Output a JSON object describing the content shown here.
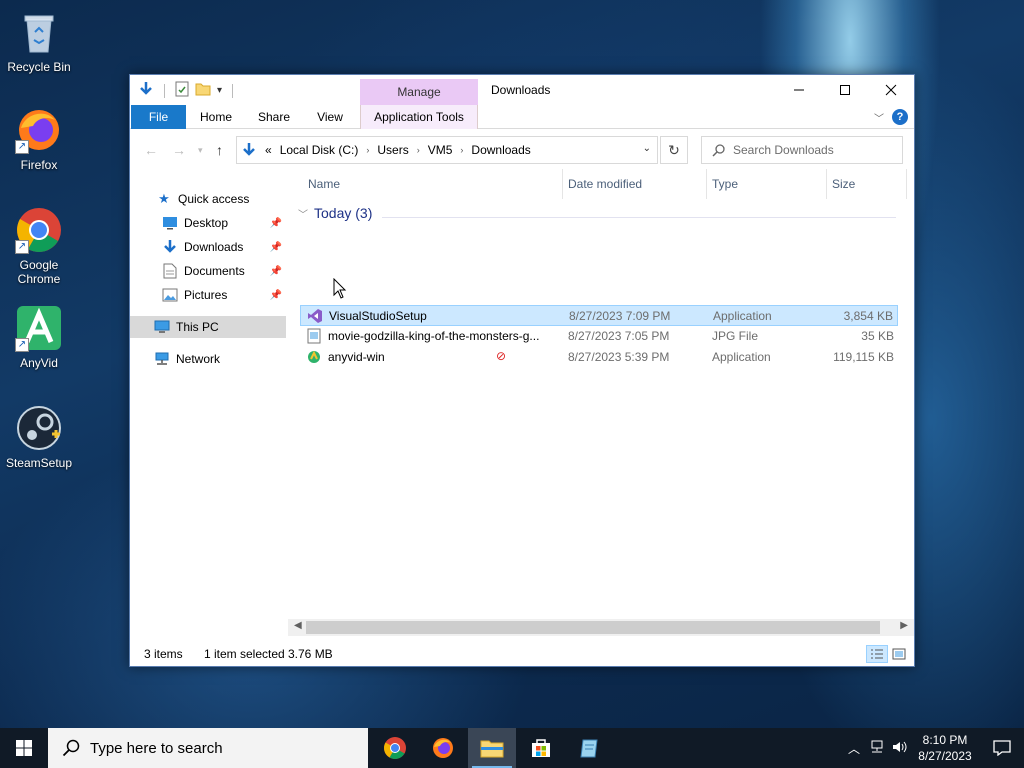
{
  "desktop": {
    "icons": [
      {
        "label": "Recycle Bin"
      },
      {
        "label": "Firefox"
      },
      {
        "label": "Google Chrome"
      },
      {
        "label": "AnyVid"
      },
      {
        "label": "SteamSetup"
      }
    ]
  },
  "window": {
    "title": "Downloads",
    "context_tab_group": "Manage",
    "tabs": {
      "file": "File",
      "home": "Home",
      "share": "Share",
      "view": "View",
      "app_tools": "Application Tools"
    },
    "address": {
      "prefix": "«",
      "crumbs": [
        "Local Disk (C:)",
        "Users",
        "VM5",
        "Downloads"
      ]
    },
    "search_placeholder": "Search Downloads",
    "nav": {
      "quick_access": "Quick access",
      "desktop": "Desktop",
      "downloads": "Downloads",
      "documents": "Documents",
      "pictures": "Pictures",
      "this_pc": "This PC",
      "network": "Network"
    },
    "columns": {
      "name": "Name",
      "date": "Date modified",
      "type": "Type",
      "size": "Size"
    },
    "group": "Today (3)",
    "files": [
      {
        "name": "VisualStudioSetup",
        "date": "8/27/2023 7:09 PM",
        "type": "Application",
        "size": "3,854 KB"
      },
      {
        "name": "movie-godzilla-king-of-the-monsters-g...",
        "date": "8/27/2023 7:05 PM",
        "type": "JPG File",
        "size": "35 KB"
      },
      {
        "name": "anyvid-win",
        "date": "8/27/2023 5:39 PM",
        "type": "Application",
        "size": "119,115 KB"
      }
    ],
    "status": {
      "count": "3 items",
      "selected": "1 item selected",
      "size": "3.76 MB"
    }
  },
  "taskbar": {
    "search_placeholder": "Type here to search",
    "time": "8:10 PM",
    "date": "8/27/2023"
  },
  "colors": {
    "accent": "#1979ca",
    "selection": "#cce8ff",
    "taskbar": "#101a26",
    "manage": "#eac9f5"
  }
}
